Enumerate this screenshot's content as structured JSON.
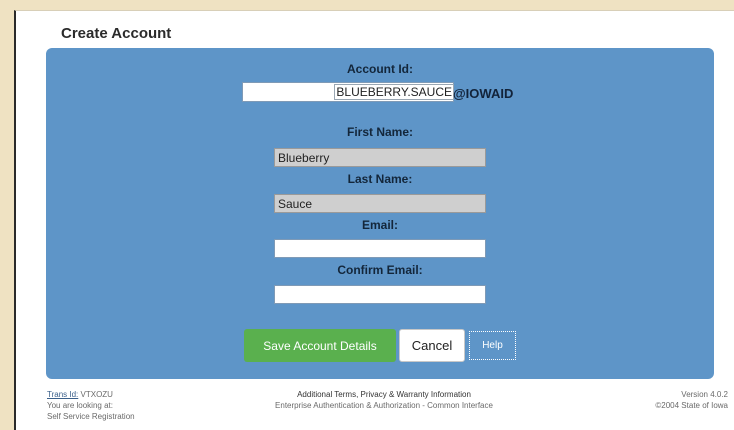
{
  "page": {
    "title": "Create Account"
  },
  "form": {
    "account_id_label": "Account Id:",
    "account_id_value": "BLUEBERRY.SAUCE",
    "account_id_suffix": "@IOWAID",
    "first_name_label": "First Name:",
    "first_name_value": "Blueberry",
    "last_name_label": "Last Name:",
    "last_name_value": "Sauce",
    "email_label": "Email:",
    "email_value": "",
    "confirm_email_label": "Confirm Email:",
    "confirm_email_value": ""
  },
  "buttons": {
    "save": "Save Account Details",
    "cancel": "Cancel",
    "help": "Help"
  },
  "footer": {
    "trans_id_label": "Trans Id:",
    "trans_id_value": "VTXOZU",
    "looking_at_label": "You are looking at:",
    "looking_at_value": "Self Service Registration",
    "terms_link": "Additional Terms, Privacy & Warranty Information",
    "app_name": "Enterprise Authentication & Authorization - Common Interface",
    "version": "Version  4.0.2",
    "copyright": "©2004 State of Iowa"
  },
  "colors": {
    "panel_bg": "#5e95c8",
    "save_button": "#5ab04e",
    "background": "#efe2c2"
  }
}
